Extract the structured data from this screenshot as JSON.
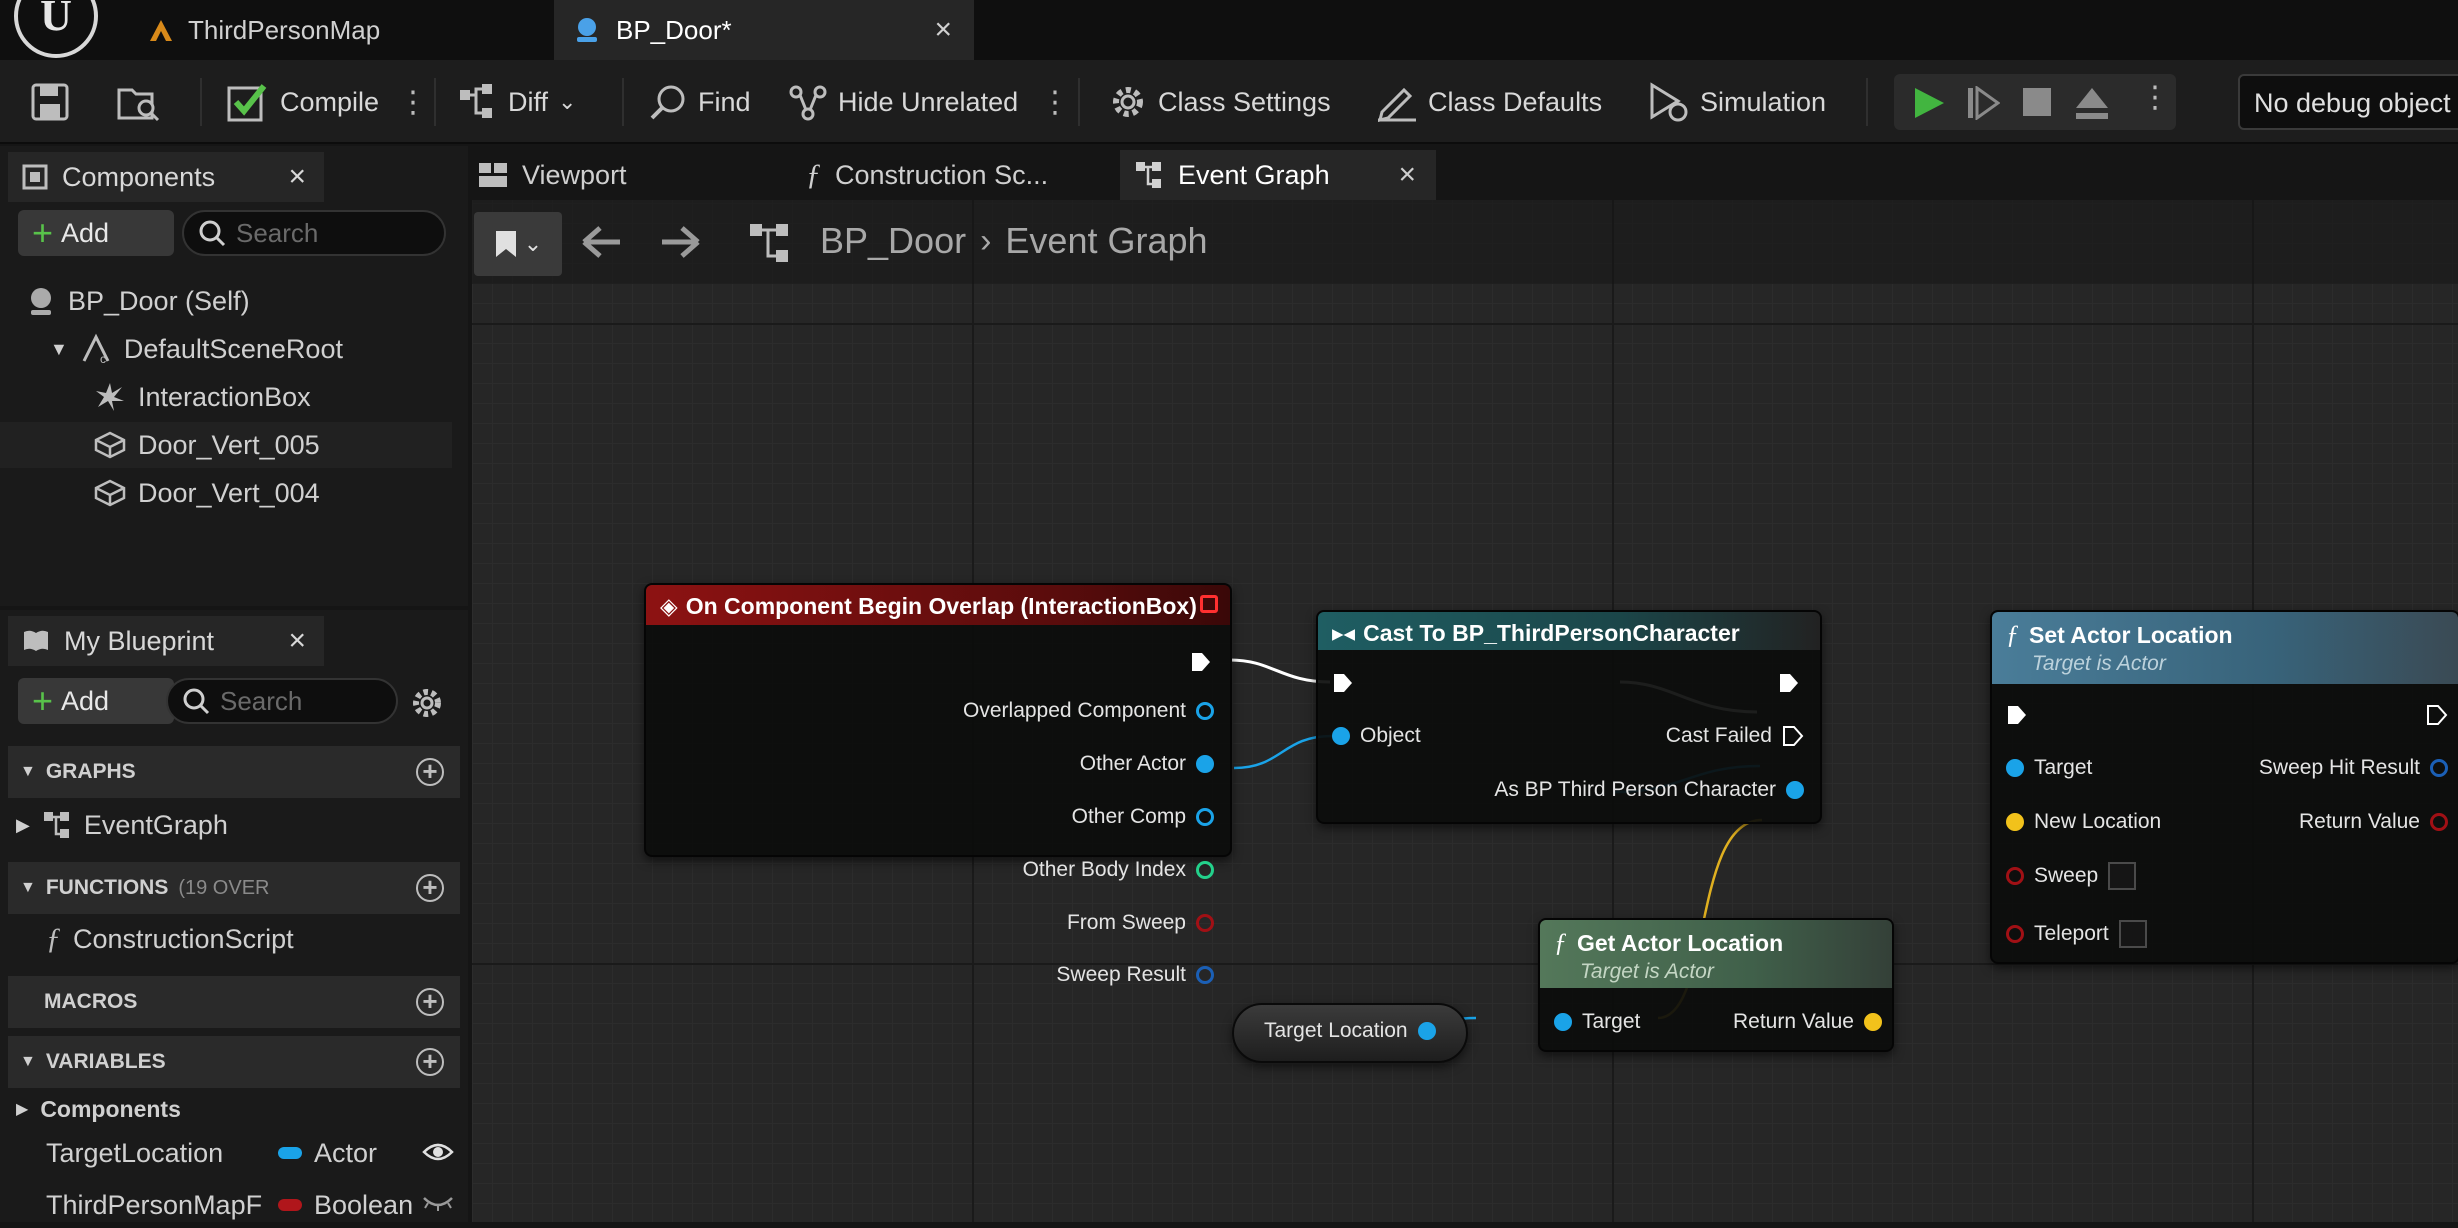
{
  "tabs": [
    {
      "label": "ThirdPersonMap"
    },
    {
      "label": "BP_Door*"
    }
  ],
  "toolbar": {
    "compile": "Compile",
    "diff": "Diff",
    "find": "Find",
    "hide_unrelated": "Hide Unrelated",
    "class_settings": "Class Settings",
    "class_defaults": "Class Defaults",
    "simulation": "Simulation",
    "debug_object": "No debug object s"
  },
  "components": {
    "title": "Components",
    "add": "Add",
    "search_placeholder": "Search",
    "tree": [
      "BP_Door (Self)",
      "DefaultSceneRoot",
      "InteractionBox",
      "Door_Vert_005",
      "Door_Vert_004"
    ]
  },
  "my_blueprint": {
    "title": "My Blueprint",
    "add": "Add",
    "search_placeholder": "Search",
    "sections": {
      "graphs": "GRAPHS",
      "functions": "FUNCTIONS",
      "functions_note": "(19 OVER",
      "macros": "MACROS",
      "variables": "VARIABLES"
    },
    "event_graph": "EventGraph",
    "construction_script": "ConstructionScript",
    "components_category": "Components",
    "variables": [
      {
        "name": "TargetLocation",
        "type": "Actor",
        "type_color": "#1aa3e8"
      },
      {
        "name": "ThirdPersonMapF",
        "type": "Boolean",
        "type_color": "#b0161b"
      }
    ]
  },
  "graph_tabs": {
    "viewport": "Viewport",
    "construction": "Construction Sc...",
    "event_graph": "Event Graph"
  },
  "breadcrumb": {
    "root": "BP_Door",
    "current": "Event Graph"
  },
  "nodes": {
    "overlap": {
      "title": "On Component Begin Overlap (InteractionBox)",
      "pins": [
        "Overlapped Component",
        "Other Actor",
        "Other Comp",
        "Other Body Index",
        "From Sweep",
        "Sweep Result"
      ]
    },
    "cast": {
      "title": "Cast To BP_ThirdPersonCharacter",
      "object": "Object",
      "cast_failed": "Cast Failed",
      "as_char": "As BP Third Person Character"
    },
    "set_loc": {
      "title": "Set Actor Location",
      "subtitle": "Target is Actor",
      "target": "Target",
      "new_location": "New Location",
      "sweep": "Sweep",
      "teleport": "Teleport",
      "sweep_hit": "Sweep Hit Result",
      "return_value": "Return Value"
    },
    "get_loc": {
      "title": "Get Actor Location",
      "subtitle": "Target is Actor",
      "target": "Target",
      "return_value": "Return Value"
    },
    "var_get": {
      "label": "Target Location"
    }
  },
  "colors": {
    "event_header": "#8d1212",
    "cast_header": "#1f5e63",
    "function_header": "#4a7d99",
    "pure_header": "#54785a",
    "object_pin": "#1aa3e8",
    "vector_pin": "#f2c21b",
    "bool_pin": "#a11015",
    "int_pin": "#23d18b",
    "struct_pin": "#1b5fb5",
    "play_green": "#42b540"
  }
}
